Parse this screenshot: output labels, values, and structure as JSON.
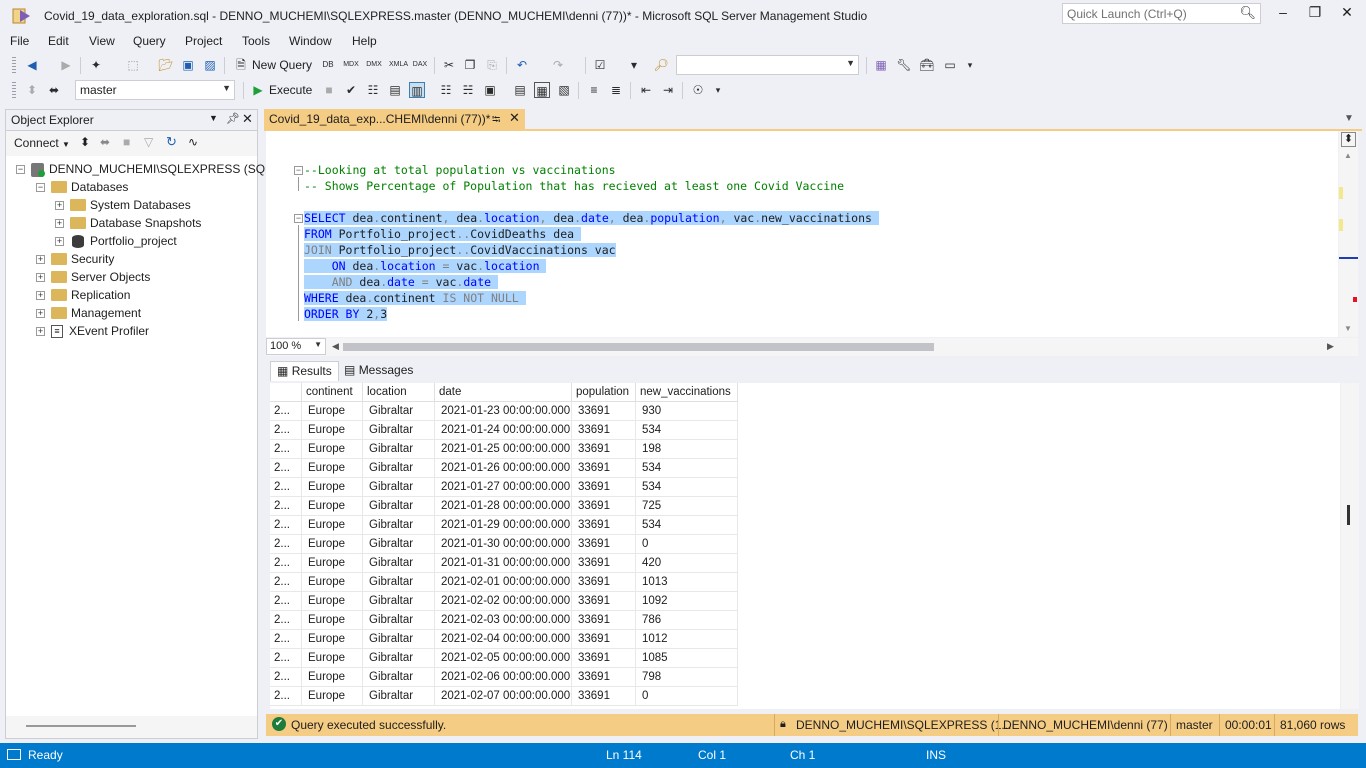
{
  "window": {
    "title": "Covid_19_data_exploration.sql - DENNO_MUCHEMI\\SQLEXPRESS.master (DENNO_MUCHEMI\\denni (77))* - Microsoft SQL Server Management Studio",
    "quick_launch_placeholder": "Quick Launch (Ctrl+Q)"
  },
  "menu": [
    "File",
    "Edit",
    "View",
    "Query",
    "Project",
    "Tools",
    "Window",
    "Help"
  ],
  "toolbar": {
    "new_query_label": "New Query",
    "database_value": "master",
    "execute_label": "Execute"
  },
  "object_explorer": {
    "title": "Object Explorer",
    "connect_label": "Connect",
    "server": "DENNO_MUCHEMI\\SQLEXPRESS (SQL",
    "databases": "Databases",
    "system_databases": "System Databases",
    "database_snapshots": "Database Snapshots",
    "portfolio_project": "Portfolio_project",
    "security": "Security",
    "server_objects": "Server Objects",
    "replication": "Replication",
    "management": "Management",
    "xevent_profiler": "XEvent Profiler"
  },
  "document_tab": {
    "label": "Covid_19_data_exp...CHEMI\\denni (77))*"
  },
  "editor": {
    "comment1": "--Looking at total population vs vaccinations",
    "comment2": "-- Shows Percentage of Population that has recieved at least one Covid Vaccine",
    "zoom": "100 %"
  },
  "results": {
    "results_tab": "Results",
    "messages_tab": "Messages",
    "columns": [
      "continent",
      "location",
      "date",
      "population",
      "new_vaccinations"
    ],
    "rows": [
      [
        "2...",
        "Europe",
        "Gibraltar",
        "2021-01-23 00:00:00.000",
        "33691",
        "930"
      ],
      [
        "2...",
        "Europe",
        "Gibraltar",
        "2021-01-24 00:00:00.000",
        "33691",
        "534"
      ],
      [
        "2...",
        "Europe",
        "Gibraltar",
        "2021-01-25 00:00:00.000",
        "33691",
        "198"
      ],
      [
        "2...",
        "Europe",
        "Gibraltar",
        "2021-01-26 00:00:00.000",
        "33691",
        "534"
      ],
      [
        "2...",
        "Europe",
        "Gibraltar",
        "2021-01-27 00:00:00.000",
        "33691",
        "534"
      ],
      [
        "2...",
        "Europe",
        "Gibraltar",
        "2021-01-28 00:00:00.000",
        "33691",
        "725"
      ],
      [
        "2...",
        "Europe",
        "Gibraltar",
        "2021-01-29 00:00:00.000",
        "33691",
        "534"
      ],
      [
        "2...",
        "Europe",
        "Gibraltar",
        "2021-01-30 00:00:00.000",
        "33691",
        "0"
      ],
      [
        "2...",
        "Europe",
        "Gibraltar",
        "2021-01-31 00:00:00.000",
        "33691",
        "420"
      ],
      [
        "2...",
        "Europe",
        "Gibraltar",
        "2021-02-01 00:00:00.000",
        "33691",
        "1013"
      ],
      [
        "2...",
        "Europe",
        "Gibraltar",
        "2021-02-02 00:00:00.000",
        "33691",
        "1092"
      ],
      [
        "2...",
        "Europe",
        "Gibraltar",
        "2021-02-03 00:00:00.000",
        "33691",
        "786"
      ],
      [
        "2...",
        "Europe",
        "Gibraltar",
        "2021-02-04 00:00:00.000",
        "33691",
        "1012"
      ],
      [
        "2...",
        "Europe",
        "Gibraltar",
        "2021-02-05 00:00:00.000",
        "33691",
        "1085"
      ],
      [
        "2...",
        "Europe",
        "Gibraltar",
        "2021-02-06 00:00:00.000",
        "33691",
        "798"
      ],
      [
        "2...",
        "Europe",
        "Gibraltar",
        "2021-02-07 00:00:00.000",
        "33691",
        "0"
      ]
    ]
  },
  "query_status": {
    "message": "Query executed successfully.",
    "server": "DENNO_MUCHEMI\\SQLEXPRESS (1...",
    "user": "DENNO_MUCHEMI\\denni (77)",
    "database": "master",
    "elapsed": "00:00:01",
    "rows": "81,060 rows"
  },
  "statusbar": {
    "ready": "Ready",
    "line": "Ln 114",
    "col": "Col 1",
    "ch": "Ch 1",
    "mode": "INS"
  }
}
